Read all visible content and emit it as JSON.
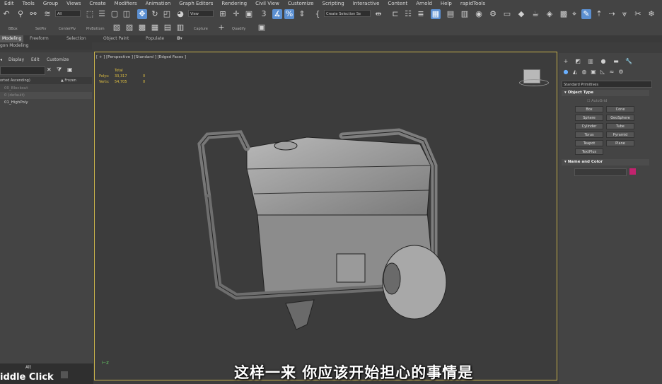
{
  "menu": [
    "Edit",
    "Tools",
    "Group",
    "Views",
    "Create",
    "Modifiers",
    "Animation",
    "Graph Editors",
    "Rendering",
    "Civil View",
    "Customize",
    "Scripting",
    "Interactive",
    "Content",
    "Arnold",
    "Help",
    "rapidTools"
  ],
  "toolbar": {
    "selection_filter": "All",
    "ref_coord": "View",
    "named_selection": "Create Selection Se",
    "tool_labels": [
      "BBox",
      "SetPiv",
      "CenterPiv",
      "PivBottom",
      "Capture",
      "Quadify"
    ]
  },
  "ribbon": {
    "tabs": [
      "Modeling",
      "Freeform",
      "Selection",
      "Object Paint",
      "Populate"
    ],
    "active_tab": "Modeling",
    "sub_label": "gon Modeling"
  },
  "explorer": {
    "menu": [
      "Display",
      "Edit",
      "Customize"
    ],
    "sort_header": "orted Ascending)",
    "frozen_header": "▲ Frozen",
    "rows": [
      {
        "label": "00_Blockout",
        "dim": true
      },
      {
        "label": "0 (default)",
        "dim": true
      },
      {
        "label": "01_HighPoly",
        "dim": false
      }
    ]
  },
  "viewport": {
    "label": "[ + ] [Perspective ] [Standard ] [Edged Faces ]",
    "stats": {
      "header": "Total",
      "polys_label": "Polys:",
      "polys_total": "33,317",
      "polys_sel": "0",
      "verts_label": "Verts:",
      "verts_total": "54,705",
      "verts_sel": "0"
    }
  },
  "command_panel": {
    "category": "Standard Primitives",
    "object_type_title": "Object Type",
    "autogrid": "AutoGrid",
    "buttons": [
      "Box",
      "Cone",
      "Sphere",
      "GeoSphere",
      "Cylinder",
      "Tube",
      "Torus",
      "Pyramid",
      "Teapot",
      "Plane",
      "TextPlus"
    ],
    "name_color_title": "Name and Color",
    "object_color": "#c2236e"
  },
  "status": {
    "alt_label": "Alt",
    "mid_label": "iddle Click"
  },
  "subtitle": "这样一来 你应该开始担心的事情是",
  "colors": {
    "accent": "#5b8fd1",
    "viewport_border": "#c9b24b",
    "stats": "#e0c040"
  }
}
